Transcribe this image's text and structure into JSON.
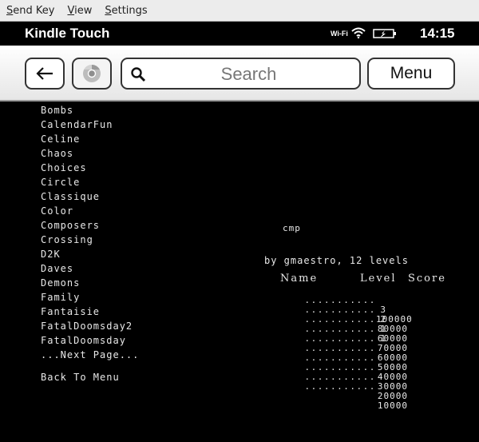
{
  "menubar": {
    "items": [
      {
        "mnemonic": "S",
        "rest": "end Key"
      },
      {
        "mnemonic": "V",
        "rest": "iew"
      },
      {
        "mnemonic": "S",
        "rest": "ettings"
      }
    ]
  },
  "status": {
    "title": "Kindle Touch",
    "wifi_label": "Wi-Fi",
    "time": "14:15",
    "icons": [
      "wifi-icon",
      "battery-charging-icon"
    ]
  },
  "toolbar": {
    "back_icon": "arrow-left-icon",
    "browser_icon": "chrome-icon",
    "search_placeholder": "Search",
    "menu_label": "Menu"
  },
  "list": {
    "items": [
      "Bombs",
      "CalendarFun",
      "Celine",
      "Chaos",
      "Choices",
      "Circle",
      "Classique",
      "Color",
      "Composers",
      "Crossing",
      "D2K",
      "Daves",
      "Demons",
      "Family",
      "Fantaisie",
      "FatalDoomsday2",
      "FatalDoomsday"
    ],
    "next_page": "...Next Page...",
    "back_to_menu": "Back To Menu"
  },
  "game": {
    "title": "cmp",
    "byline": "by gmaestro, 12 levels",
    "headers": {
      "name": "Name",
      "level": "Level",
      "score": "Score"
    },
    "scores": [
      {
        "name": "...........",
        "level": "3",
        "score": "100000"
      },
      {
        "name": "...........",
        "level": "2",
        "score": "80000"
      },
      {
        "name": "...........",
        "level": "1",
        "score": "60000"
      },
      {
        "name": "...........",
        "level": "1",
        "score": "70000"
      },
      {
        "name": "...........",
        "level": "",
        "score": "60000"
      },
      {
        "name": "...........",
        "level": "",
        "score": "50000"
      },
      {
        "name": "...........",
        "level": "",
        "score": "40000"
      },
      {
        "name": "...........",
        "level": "",
        "score": "30000"
      },
      {
        "name": "...........",
        "level": "",
        "score": "20000"
      },
      {
        "name": "...........",
        "level": "",
        "score": "10000"
      }
    ]
  }
}
